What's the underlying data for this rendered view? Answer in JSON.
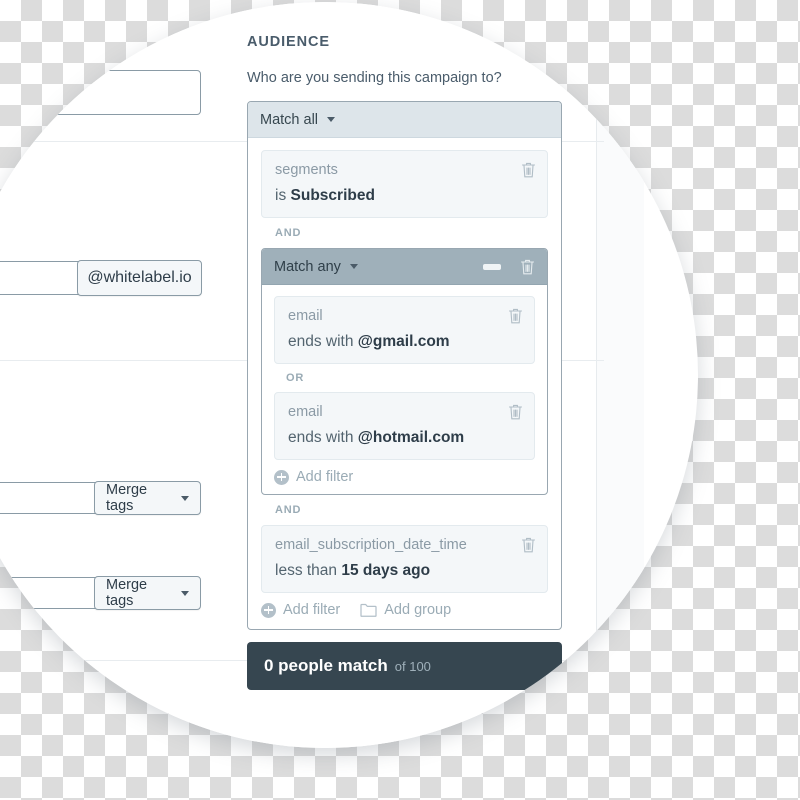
{
  "section": {
    "title": "AUDIENCE",
    "subtitle": "Who are you sending this campaign to?"
  },
  "root_group": {
    "match_label": "Match all",
    "filters": [
      {
        "field": "segments",
        "operator": "is",
        "value": "Subscribed"
      }
    ]
  },
  "nested_group": {
    "match_label": "Match any",
    "conjunction_before": "AND",
    "conjunction_inner": "OR",
    "filters": [
      {
        "field": "email",
        "operator": "ends with",
        "value": "@gmail.com"
      },
      {
        "field": "email",
        "operator": "ends with",
        "value": "@hotmail.com"
      }
    ],
    "add_filter_label": "Add filter"
  },
  "tail": {
    "conjunction_before": "AND",
    "filter": {
      "field": "email_subscription_date_time",
      "operator": "less than",
      "value": "15 days ago"
    },
    "add_filter_label": "Add filter",
    "add_group_label": "Add group"
  },
  "summary": {
    "count_text": "0 people match",
    "total_text": "of 100"
  },
  "left_form": {
    "email_domain_addon": "@whitelabel.io",
    "merge_tags_label_1": "Merge tags",
    "merge_tags_label_2": "Merge tags"
  },
  "colors": {
    "panel_border": "#99a7b1",
    "match_all_header_bg": "#dde5ea",
    "match_any_header_bg": "#9fb0ba",
    "filter_bg": "#f4f7f9",
    "summary_bg": "#364650",
    "muted_text": "#9aabb5",
    "strong_text": "#2e3d49"
  }
}
